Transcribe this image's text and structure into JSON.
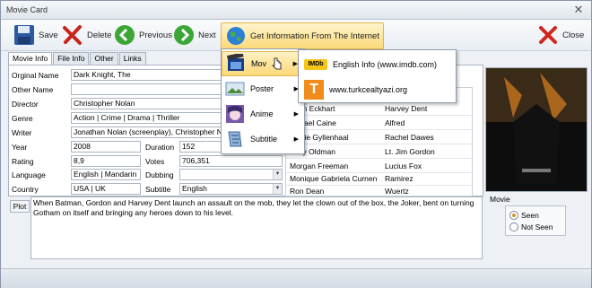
{
  "window": {
    "title": "Movie Card",
    "close_symbol": "✕"
  },
  "toolbar": {
    "save_label": "Save",
    "delete_label": "Delete",
    "previous_label": "Previous",
    "next_label": "Next",
    "get_info_label": "Get Information From The Internet",
    "close_label": "Close"
  },
  "tabs": [
    "Movie Info",
    "File Info",
    "Other",
    "Links"
  ],
  "fields": {
    "original_name": {
      "label": "Orginal Name",
      "value": "Dark Knight, The"
    },
    "other_name": {
      "label": "Other Name",
      "value": ""
    },
    "director": {
      "label": "Director",
      "value": "Christopher Nolan"
    },
    "genre": {
      "label": "Genre",
      "value": "Action | Crime | Drama | Thriller"
    },
    "writer": {
      "label": "Writer",
      "value": "Jonathan Nolan (screenplay), Christopher Nolan"
    },
    "year": {
      "label": "Year",
      "value": "2008"
    },
    "duration": {
      "label": "Duration",
      "value": "152"
    },
    "rating": {
      "label": "Rating",
      "value": "8,9"
    },
    "votes": {
      "label": "Votes",
      "value": "706,351"
    },
    "language": {
      "label": "Language",
      "value": "English | Mandarin"
    },
    "dubbing": {
      "label": "Dubbing",
      "value": ""
    },
    "country": {
      "label": "Country",
      "value": "USA | UK"
    },
    "subtitle": {
      "label": "Subtitle",
      "value": "English"
    }
  },
  "cast": [
    {
      "actor": "Aaron Eckhart",
      "actor_visible": "ron Eckhart",
      "role": "Harvey Dent"
    },
    {
      "actor": "Michael Caine",
      "actor_visible": "chael Caine",
      "role": "Alfred"
    },
    {
      "actor": "Maggie Gyllenhaal",
      "actor_visible": "ggie Gyllenhaal",
      "role": "Rachel Dawes"
    },
    {
      "actor": "Gary Oldman",
      "actor_visible": "ary Oldman",
      "role": "Lt. Jim Gordon"
    },
    {
      "actor": "Morgan Freeman",
      "actor_visible": "Morgan Freeman",
      "role": "Lucius Fox"
    },
    {
      "actor": "Monique Gabriela Curnen",
      "actor_visible": "Monique Gabriela Curnen",
      "role": "Ramirez"
    },
    {
      "actor": "Ron Dean",
      "actor_visible": "Ron Dean",
      "role": "Wuertz"
    }
  ],
  "plot": {
    "label": "Plot",
    "text": "When Batman, Gordon and Harvey Dent launch an assault on the mob, they let the clown out of the box, the Joker, bent on turning Gotham on itself and bringing any heroes down to his level."
  },
  "movie_status": {
    "label": "Movie",
    "options": [
      "Seen",
      "Not Seen"
    ],
    "selected": "Seen"
  },
  "context_menu": {
    "items": [
      "Movie",
      "Poster",
      "Anime",
      "Subtitle"
    ],
    "highlighted": "Movie",
    "visible_text": "Mov"
  },
  "submenu": {
    "items": [
      {
        "icon_text": "IMDb",
        "label": "English Info (www.imdb.com)"
      },
      {
        "icon_text": "T",
        "label": "www.turkcealtyazi.org"
      }
    ]
  },
  "colors": {
    "accent": "#fbd97a",
    "highlight_border": "#e2b64a",
    "imdb": "#f5c518",
    "turkce": "#f08c1c"
  },
  "icons": [
    "save-icon",
    "delete-icon",
    "previous-icon",
    "next-icon",
    "globe-icon",
    "close-icon",
    "film-icon",
    "poster-icon",
    "anime-icon",
    "subtitle-icon"
  ]
}
